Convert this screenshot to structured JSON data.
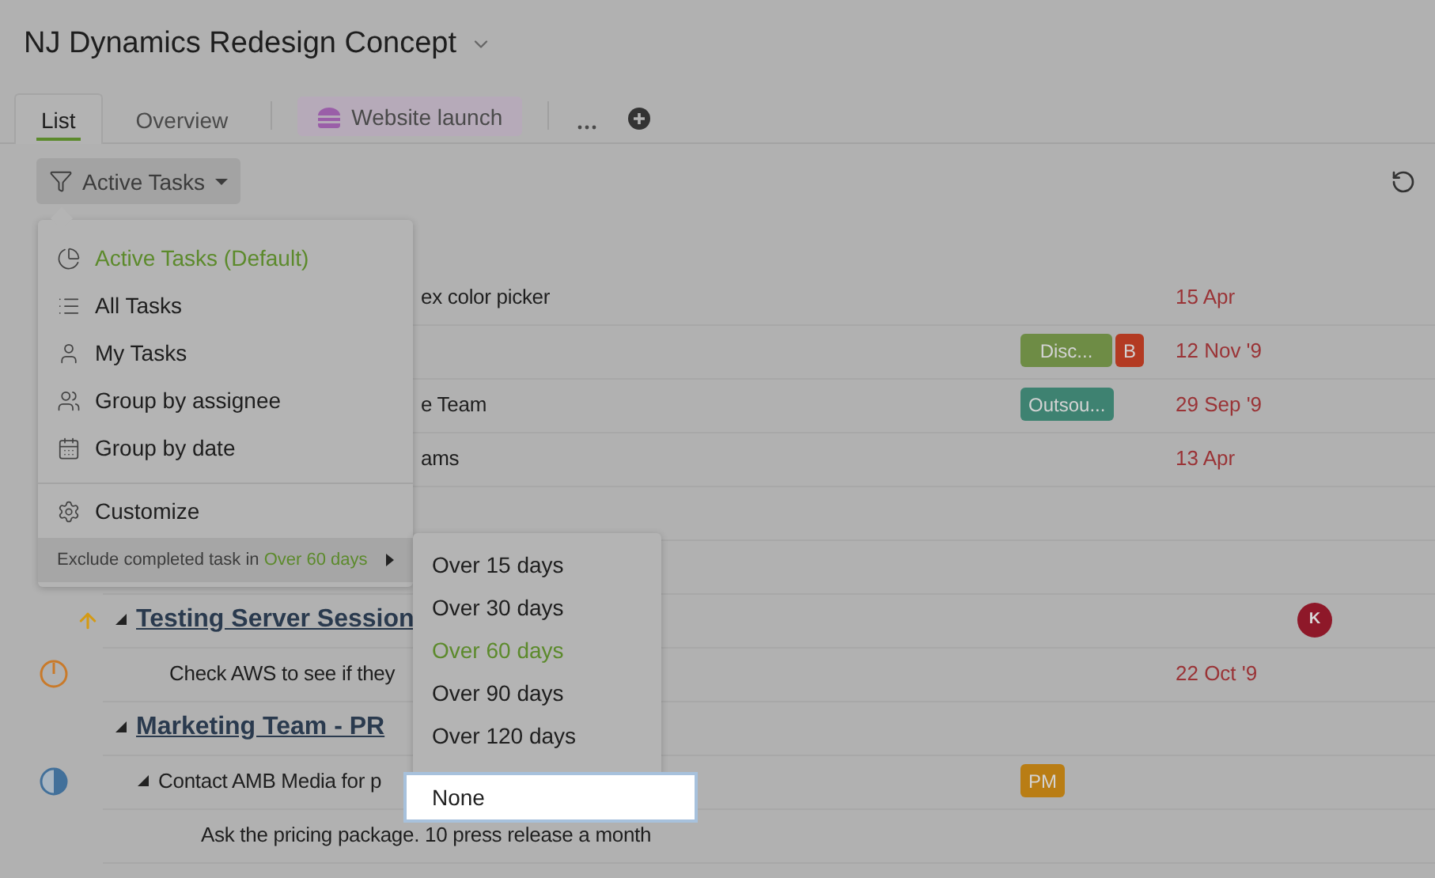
{
  "project": {
    "title": "NJ Dynamics Redesign Concept"
  },
  "tabs": [
    {
      "label": "List",
      "selected": true,
      "kind": "view"
    },
    {
      "label": "Overview",
      "selected": false,
      "kind": "view"
    },
    {
      "label": "Website launch",
      "selected": false,
      "kind": "milestone"
    }
  ],
  "filter": {
    "label": "Active Tasks"
  },
  "tasks": [
    {
      "title": "ex color picker",
      "kind": "clipped",
      "date": "15 Apr"
    },
    {
      "kind": "clipped",
      "tags": [
        {
          "label": "Disc...",
          "color": "#6e8c45"
        },
        {
          "label": "B",
          "color": "#b33a22"
        }
      ],
      "date": "12 Nov '9"
    },
    {
      "title": "e Team",
      "kind": "clipped",
      "tags": [
        {
          "label": "Outsou...",
          "color": "#3e8271"
        }
      ],
      "date": "29 Sep '9"
    },
    {
      "title": "ams",
      "kind": "clipped",
      "date": "13 Apr"
    },
    {
      "kind": "blank"
    },
    {
      "kind": "blank"
    },
    {
      "title": "Testing Server Session",
      "kind": "group",
      "high_priority": true,
      "expanded": true,
      "assignee": "K",
      "children": [
        {
          "title": "Check AWS to see if they",
          "kind": "task",
          "level": 0,
          "date": "22 Oct '9"
        }
      ]
    },
    {
      "title": "Marketing Team - PR",
      "kind": "group",
      "expanded": true,
      "children": [
        {
          "title": "Contact AMB Media for p",
          "kind": "task",
          "level": 0.5,
          "expanded": true,
          "tags": [
            {
              "label": "PM",
              "color": "#b97d14"
            }
          ],
          "children": [
            {
              "title": "Ask the pricing package. 10 press release a month",
              "kind": "task"
            }
          ]
        }
      ]
    }
  ],
  "view_menu": {
    "items": [
      {
        "label": "Active Tasks (Default)",
        "selected": true,
        "kind": "pie"
      },
      {
        "label": "All Tasks",
        "selected": false,
        "kind": "list"
      },
      {
        "label": "My Tasks",
        "selected": false,
        "kind": "user"
      },
      {
        "label": "Group by assignee",
        "selected": false,
        "kind": "users"
      },
      {
        "label": "Group by date",
        "selected": false,
        "kind": "calendar"
      }
    ],
    "customize": "Customize",
    "exclude": {
      "label": "Exclude completed task in",
      "value": "Over 60 days"
    }
  },
  "exclude_menu": {
    "items": [
      {
        "label": "Over 15 days",
        "selected": false,
        "highlighted": false
      },
      {
        "label": "Over 30 days",
        "selected": false,
        "highlighted": false
      },
      {
        "label": "Over 60 days",
        "selected": true,
        "highlighted": false
      },
      {
        "label": "Over 90 days",
        "selected": false,
        "highlighted": false
      },
      {
        "label": "Over 120 days",
        "selected": false,
        "highlighted": false
      },
      {
        "label": "None",
        "selected": false,
        "highlighted": true
      }
    ]
  }
}
